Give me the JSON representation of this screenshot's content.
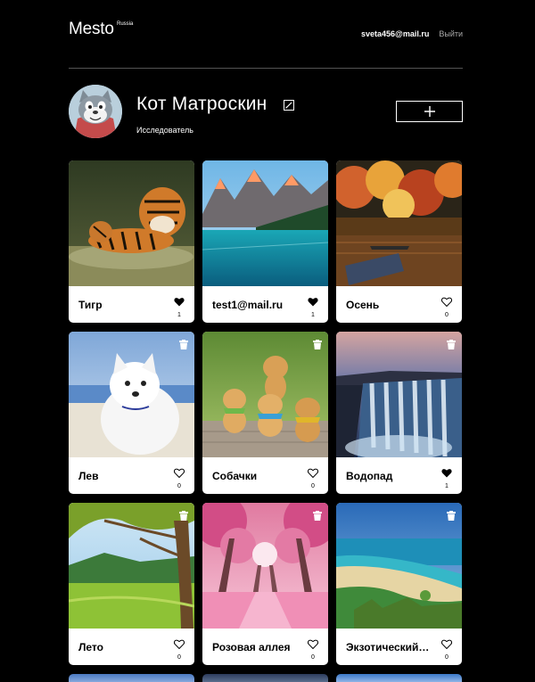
{
  "header": {
    "logo": "Mesto",
    "logo_sup": "Russia",
    "email": "sveta456@mail.ru",
    "logout": "Выйти"
  },
  "profile": {
    "name": "Кот Матроскин",
    "about": "Исследователь"
  },
  "cards": [
    {
      "title": "Тигр",
      "likes": "1",
      "liked": true,
      "deletable": false,
      "image": "tiger"
    },
    {
      "title": "test1@mail.ru",
      "likes": "1",
      "liked": true,
      "deletable": false,
      "image": "mountain-lake"
    },
    {
      "title": "Осень",
      "likes": "0",
      "liked": false,
      "deletable": false,
      "image": "autumn-lake"
    },
    {
      "title": "Лев",
      "likes": "0",
      "liked": false,
      "deletable": true,
      "image": "white-puppy"
    },
    {
      "title": "Собачки",
      "likes": "0",
      "liked": false,
      "deletable": true,
      "image": "puppies"
    },
    {
      "title": "Водопад",
      "likes": "1",
      "liked": true,
      "deletable": true,
      "image": "waterfall"
    },
    {
      "title": "Лето",
      "likes": "0",
      "liked": false,
      "deletable": true,
      "image": "summer-tree"
    },
    {
      "title": "Розовая аллея",
      "likes": "0",
      "liked": false,
      "deletable": true,
      "image": "pink-alley"
    },
    {
      "title": "Экзотический…",
      "likes": "0",
      "liked": false,
      "deletable": true,
      "image": "tropical-beach"
    }
  ],
  "colors": {
    "background": "#000000",
    "card": "#ffffff",
    "muted": "#a9a9a9",
    "divider": "#545454"
  }
}
